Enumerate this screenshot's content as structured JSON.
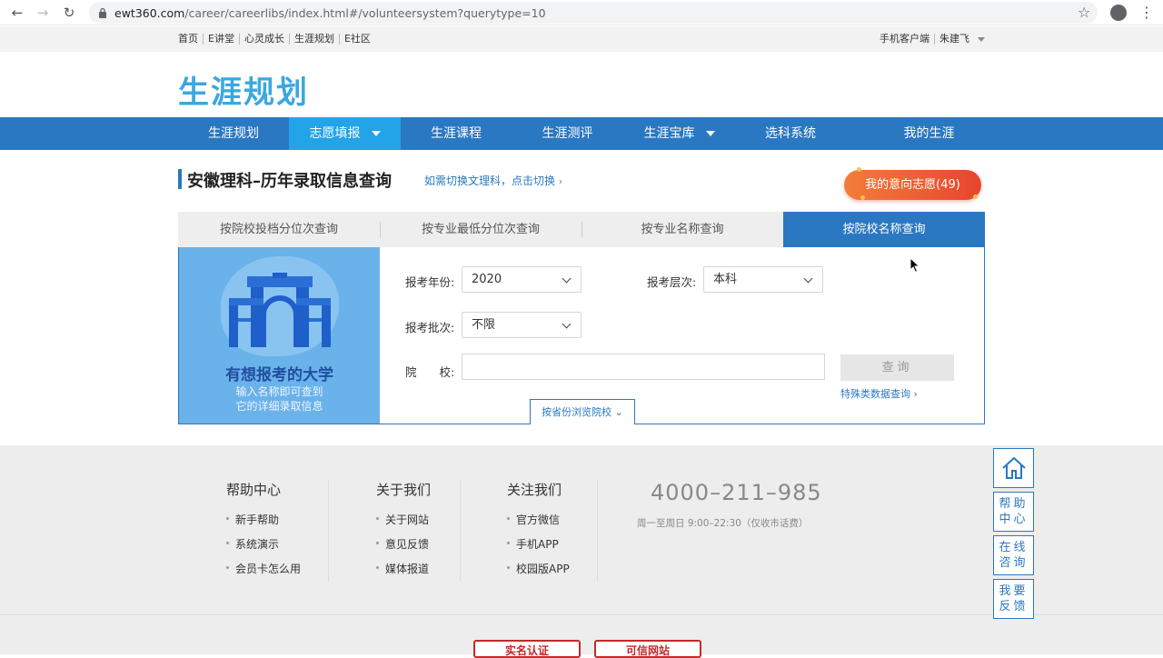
{
  "browser": {
    "url_domain": "ewt360.com",
    "url_path": "/career/careerlibs/index.html#/volunteersystem?querytype=10",
    "back_icon": "back-arrow-icon",
    "forward_icon": "forward-arrow-icon",
    "reload_icon": "reload-icon"
  },
  "top_bar": {
    "links": [
      "首页",
      "E讲堂",
      "心灵成长",
      "生涯规划",
      "E社区"
    ],
    "mobile_client": "手机客户端",
    "user_name": "朱建飞"
  },
  "logo_text": "生涯规划",
  "nav": {
    "items": [
      "生涯规划",
      "志愿填报",
      "生涯课程",
      "生涯测评",
      "生涯宝库",
      "选科系统",
      "我的生涯"
    ],
    "active_index": 1
  },
  "page": {
    "title": "安徽理科–历年录取信息查询",
    "switch_link": "如需切换文理科，点击切换",
    "my_wish_button": "我的意向志愿(49)"
  },
  "tabs": [
    "按院校投档分位次查询",
    "按专业最低分位次查询",
    "按专业名称查询",
    "按院校名称查询"
  ],
  "active_tab": 3,
  "promo": {
    "title": "有想报考的大学",
    "subtitle_line1": "输入名称即可查到",
    "subtitle_line2": "它的详细录取信息"
  },
  "form": {
    "year_label": "报考年份:",
    "year_value": "2020",
    "level_label": "报考层次:",
    "level_value": "本科",
    "batch_label": "报考批次:",
    "batch_value": "不限",
    "school_label": "院　　校:",
    "school_value": "",
    "query_button": "查询",
    "special_link": "特殊类数据查询",
    "browse_button": "按省份浏览院校"
  },
  "footer": {
    "help": {
      "title": "帮助中心",
      "items": [
        "新手帮助",
        "系统演示",
        "会员卡怎么用"
      ]
    },
    "about": {
      "title": "关于我们",
      "items": [
        "关于网站",
        "意见反馈",
        "媒体报道"
      ]
    },
    "follow": {
      "title": "关注我们",
      "items": [
        "官方微信",
        "手机APP",
        "校园版APP"
      ]
    },
    "phone": "4000–211–985",
    "phone_note": "周一至周日 9:00–22:30（仅收市话费）",
    "badge1": "实名认证",
    "badge2": "可信网站"
  },
  "side_float": {
    "home_icon": "home-icon",
    "help_line1": "帮助",
    "help_line2": "中心",
    "consult_line1": "在线",
    "consult_line2": "咨询",
    "feedback_line1": "我要",
    "feedback_line2": "反馈"
  },
  "colors": {
    "nav_blue": "#2a78c2",
    "active_nav": "#23a3e8",
    "wish_orange": "#e8452e"
  }
}
